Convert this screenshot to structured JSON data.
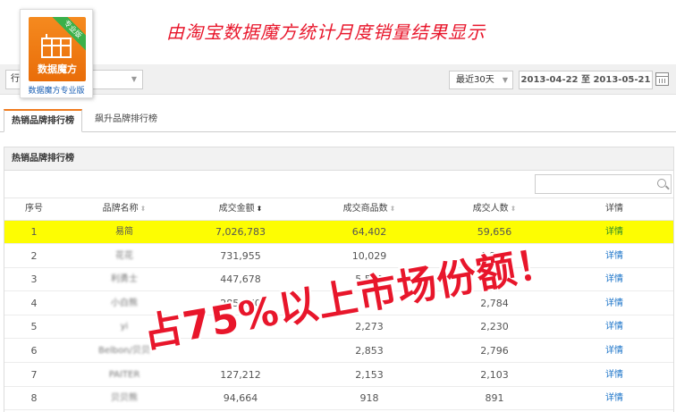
{
  "headline": "由淘宝数据魔方统计月度销量结果显示",
  "logo": {
    "badge": "专业版",
    "title": "数据魔方",
    "caption": "数据魔方专业版"
  },
  "filter": {
    "industry": "行",
    "range": "最近30天",
    "date_range": "2013-04-22 至 2013-05-21"
  },
  "tabs": [
    {
      "label": "热销品牌排行榜"
    },
    {
      "label": "飙升品牌排行榜"
    }
  ],
  "panel": {
    "title": "热销品牌排行榜"
  },
  "search": {
    "placeholder": ""
  },
  "table": {
    "headers": {
      "rank": "序号",
      "brand": "品牌名称",
      "amount": "成交金额",
      "items": "成交商品数",
      "buyers": "成交人数",
      "detail": "详情"
    },
    "rows": [
      {
        "rank": "1",
        "brand": "易简",
        "amount": "7,026,783",
        "items": "64,402",
        "buyers": "59,656",
        "detail": "详情"
      },
      {
        "rank": "2",
        "brand": "花花",
        "amount": "731,955",
        "items": "10,029",
        "buyers": "9,237",
        "detail": "详情"
      },
      {
        "rank": "3",
        "brand": "利勇士",
        "amount": "447,678",
        "items": "5,539",
        "buyers": "5,379",
        "detail": "详情"
      },
      {
        "rank": "4",
        "brand": "小白熊",
        "amount": "285,170",
        "items": "",
        "buyers": "2,784",
        "detail": "详情"
      },
      {
        "rank": "5",
        "brand": "yi",
        "amount": "",
        "items": "2,273",
        "buyers": "2,230",
        "detail": "详情"
      },
      {
        "rank": "6",
        "brand": "Belbon/贝贝",
        "amount": "",
        "items": "2,853",
        "buyers": "2,796",
        "detail": "详情"
      },
      {
        "rank": "7",
        "brand": "PAITER",
        "amount": "127,212",
        "items": "2,153",
        "buyers": "2,103",
        "detail": "详情"
      },
      {
        "rank": "8",
        "brand": "贝贝熊",
        "amount": "94,664",
        "items": "918",
        "buyers": "891",
        "detail": "详情"
      }
    ]
  },
  "slogan": "占75%以上市场份额！",
  "colors": {
    "headline": "#e8162b",
    "highlight_row": "#fdfd02",
    "logo": "#f07b1e",
    "link": "#1a73c8"
  }
}
